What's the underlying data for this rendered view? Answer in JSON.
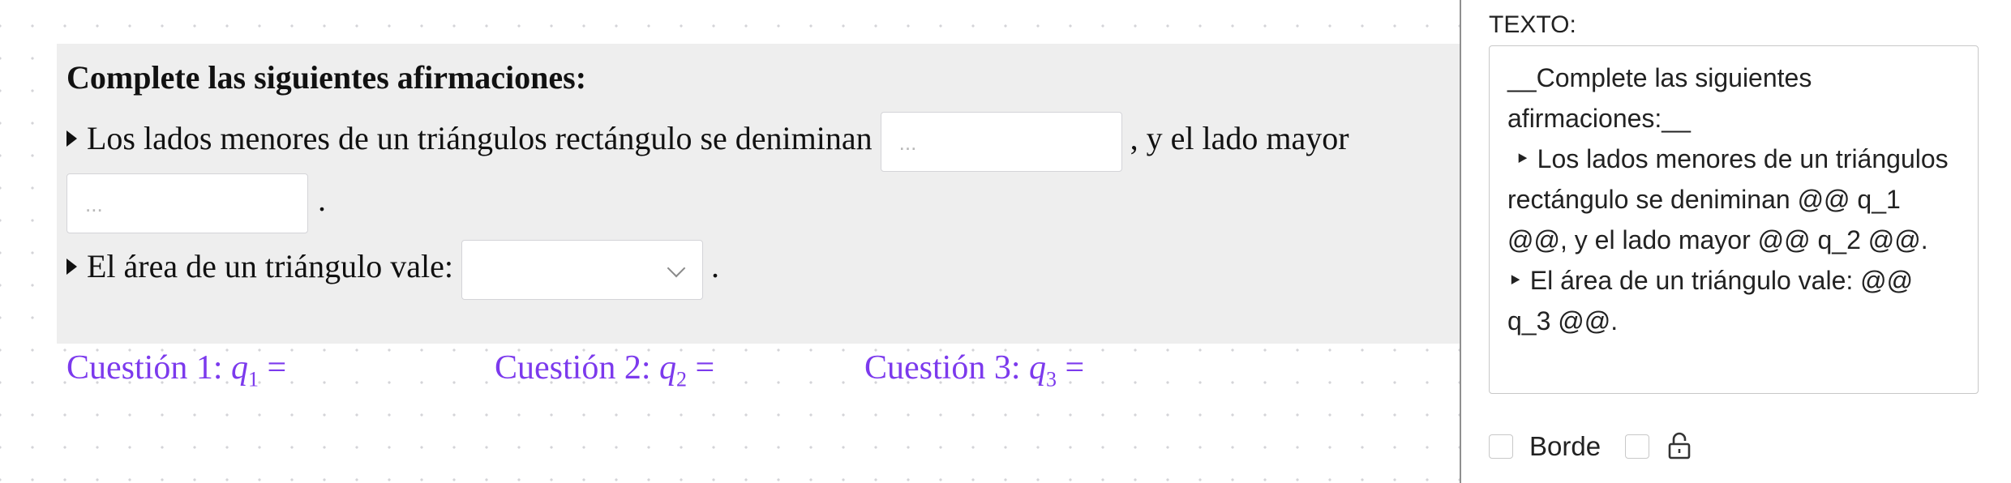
{
  "canvas": {
    "text_block": {
      "title": "Complete las siguientes afirmaciones:",
      "line1_text": "Los lados menores de un triángulos rectángulo se deniminan",
      "field_placeholder": "...",
      "line1_after": ", y el lado mayor",
      "line2_after": ".",
      "line3_text": "El área de un triángulo vale:",
      "line3_after": "."
    },
    "cuestiones": [
      {
        "label": "Cuestión 1:",
        "var": "q",
        "sub": "1",
        "eq": "="
      },
      {
        "label": "Cuestión 2:",
        "var": "q",
        "sub": "2",
        "eq": "="
      },
      {
        "label": "Cuestión 3:",
        "var": "q",
        "sub": "3",
        "eq": "="
      }
    ]
  },
  "panel": {
    "texto_label": "TEXTO:",
    "texto_value": "__Complete las siguientes afirmaciones:__\n ‣ Los lados menores de un triángulos rectángulo se deniminan @@ q_1 @@, y el lado mayor @@ q_2 @@.\n‣ El área de un triángulo vale: @@ q_3 @@.",
    "borde_label": "Borde",
    "borde_checked": false,
    "lock_checked": false
  },
  "colors": {
    "accent": "#7c3aed",
    "block_bg": "#eeeeee"
  },
  "icons": [
    "triangle-right-icon",
    "chevron-down-icon",
    "lock-icon"
  ]
}
